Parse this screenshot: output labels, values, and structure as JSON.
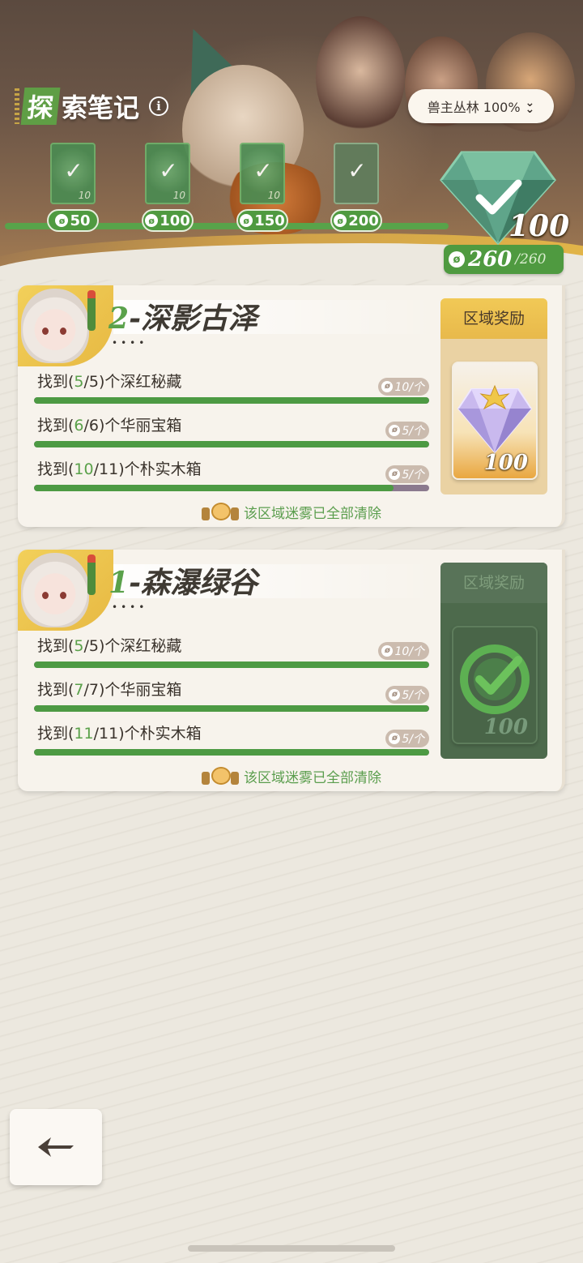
{
  "header": {
    "title_first_char": "探",
    "title_rest": "索笔记",
    "info_icon": "info-icon",
    "region_selector": {
      "label": "兽主丛林 100%",
      "icon": "double-chevron-down-icon"
    },
    "milestones": [
      {
        "cost": "50",
        "count": "10",
        "claimed": true
      },
      {
        "cost": "100",
        "count": "10",
        "claimed": true
      },
      {
        "cost": "150",
        "count": "10",
        "claimed": true
      },
      {
        "cost": "200",
        "count": "",
        "claimed": true
      }
    ],
    "big_reward_value": "100",
    "total_current": "260",
    "total_max": "/260"
  },
  "zones": [
    {
      "number": "2",
      "name": "-深影古泽",
      "dots": "••••",
      "tasks": [
        {
          "prefix": "找到(",
          "found": "5",
          "total": "/5)",
          "suffix": "个深红秘藏",
          "reward": "10/个",
          "progress": 1.0
        },
        {
          "prefix": "找到(",
          "found": "6",
          "total": "/6)",
          "suffix": "个华丽宝箱",
          "reward": "5/个",
          "progress": 1.0
        },
        {
          "prefix": "找到(",
          "found": "10",
          "total": "/11)",
          "suffix": "个朴实木箱",
          "reward": "5/个",
          "progress": 0.909
        }
      ],
      "fog_note": "该区域迷雾已全部清除",
      "reward_title": "区域奖励",
      "reward_value": "100",
      "reward_claimed": false
    },
    {
      "number": "1",
      "name": "-森瀑绿谷",
      "dots": "••••",
      "tasks": [
        {
          "prefix": "找到(",
          "found": "5",
          "total": "/5)",
          "suffix": "个深红秘藏",
          "reward": "10/个",
          "progress": 1.0
        },
        {
          "prefix": "找到(",
          "found": "7",
          "total": "/7)",
          "suffix": "个华丽宝箱",
          "reward": "5/个",
          "progress": 1.0
        },
        {
          "prefix": "找到(",
          "found": "11",
          "total": "/11)",
          "suffix": "个朴实木箱",
          "reward": "5/个",
          "progress": 1.0
        }
      ],
      "fog_note": "该区域迷雾已全部清除",
      "reward_title": "区域奖励",
      "reward_value": "100",
      "reward_claimed": true
    }
  ],
  "colors": {
    "accent_green": "#4f9a40",
    "gold": "#f1c956",
    "background": "#ece8df"
  },
  "back_button_icon": "back-arrow-icon"
}
